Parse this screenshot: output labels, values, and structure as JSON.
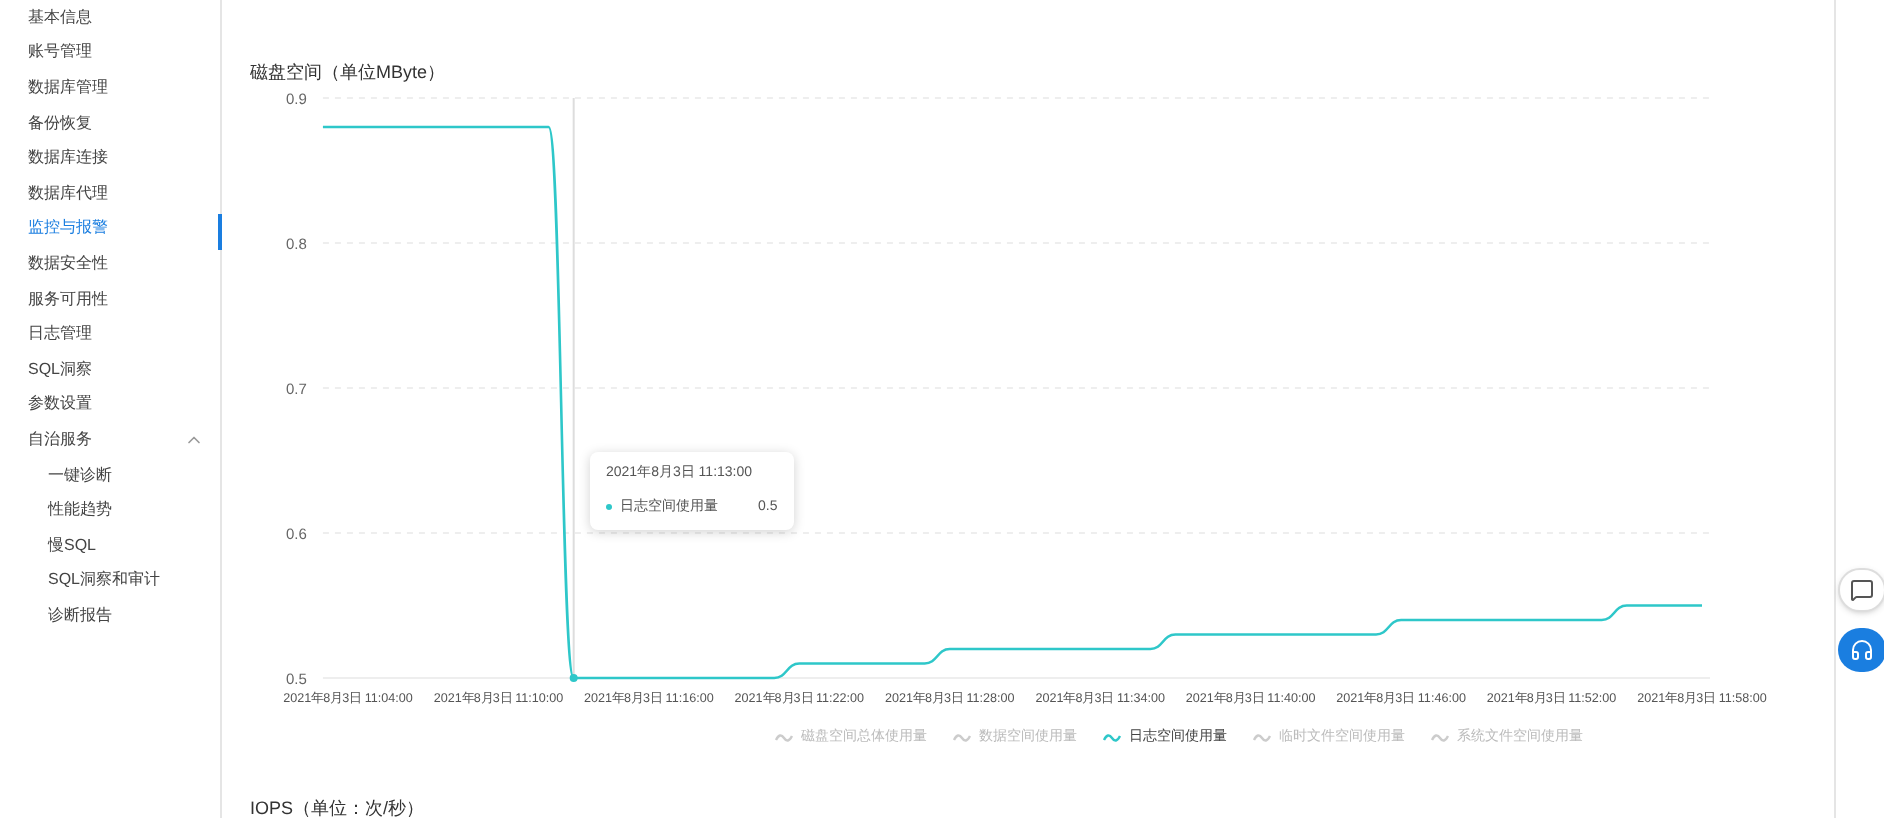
{
  "sidebar": {
    "items": [
      {
        "label": "基本信息",
        "selected": false
      },
      {
        "label": "账号管理",
        "selected": false
      },
      {
        "label": "数据库管理",
        "selected": false
      },
      {
        "label": "备份恢复",
        "selected": false
      },
      {
        "label": "数据库连接",
        "selected": false
      },
      {
        "label": "数据库代理",
        "selected": false
      },
      {
        "label": "监控与报警",
        "selected": true
      },
      {
        "label": "数据安全性",
        "selected": false
      },
      {
        "label": "服务可用性",
        "selected": false
      },
      {
        "label": "日志管理",
        "selected": false
      },
      {
        "label": "SQL洞察",
        "selected": false
      },
      {
        "label": "参数设置",
        "selected": false
      },
      {
        "label": "自治服务",
        "selected": false,
        "expanded": true,
        "children": [
          {
            "label": "一键诊断",
            "selected": false
          },
          {
            "label": "性能趋势",
            "selected": false
          },
          {
            "label": "慢SQL",
            "selected": false
          },
          {
            "label": "SQL洞察和审计",
            "selected": false
          },
          {
            "label": "诊断报告",
            "selected": false
          }
        ]
      }
    ]
  },
  "disk_panel": {
    "title": "磁盘空间（单位MByte）",
    "chart_data": {
      "type": "line",
      "categories": [
        null,
        "2021年8月3日 11:04:00",
        null,
        null,
        null,
        null,
        null,
        "2021年8月3日 11:10:00",
        null,
        null,
        null,
        null,
        null,
        "2021年8月3日 11:16:00",
        null,
        null,
        null,
        null,
        null,
        "2021年8月3日 11:22:00",
        null,
        null,
        null,
        null,
        null,
        "2021年8月3日 11:28:00",
        null,
        null,
        null,
        null,
        null,
        "2021年8月3日 11:34:00",
        null,
        null,
        null,
        null,
        null,
        "2021年8月3日 11:40:00",
        null,
        null,
        null,
        null,
        null,
        "2021年8月3日 11:46:00",
        null,
        null,
        null,
        null,
        null,
        "2021年8月3日 11:52:00",
        null,
        null,
        null,
        null,
        null,
        "2021年8月3日 11:58:00"
      ],
      "series": [
        {
          "name": "日志空间使用量",
          "color": "#2ec7c9",
          "values": [
            0.88,
            0.88,
            0.88,
            0.88,
            0.88,
            0.88,
            0.88,
            0.88,
            0.88,
            0.88,
            0.5,
            0.5,
            0.5,
            0.5,
            0.5,
            0.5,
            0.5,
            0.5,
            0.5,
            0.51,
            0.51,
            0.51,
            0.51,
            0.51,
            0.51,
            0.52,
            0.52,
            0.52,
            0.52,
            0.52,
            0.52,
            0.52,
            0.52,
            0.52,
            0.53,
            0.53,
            0.53,
            0.53,
            0.53,
            0.53,
            0.53,
            0.53,
            0.53,
            0.54,
            0.54,
            0.54,
            0.54,
            0.54,
            0.54,
            0.54,
            0.54,
            0.54,
            0.55,
            0.55,
            0.55,
            0.55
          ]
        }
      ],
      "ylim": [
        0.5,
        0.9
      ],
      "grid": true,
      "yticks": [
        0.5,
        0.6,
        0.7,
        0.8,
        0.9
      ]
    },
    "legend": [
      {
        "label": "磁盘空间总体使用量",
        "selected": false
      },
      {
        "label": "数据空间使用量",
        "selected": false
      },
      {
        "label": "日志空间使用量",
        "selected": true
      },
      {
        "label": "临时文件空间使用量",
        "selected": false
      },
      {
        "label": "系统文件空间使用量",
        "selected": false
      }
    ],
    "tooltip": {
      "time": "2021年8月3日 11:13:00",
      "value": "0.5"
    }
  },
  "next_panel": {
    "title": "IOPS（单位：次/秒）"
  }
}
